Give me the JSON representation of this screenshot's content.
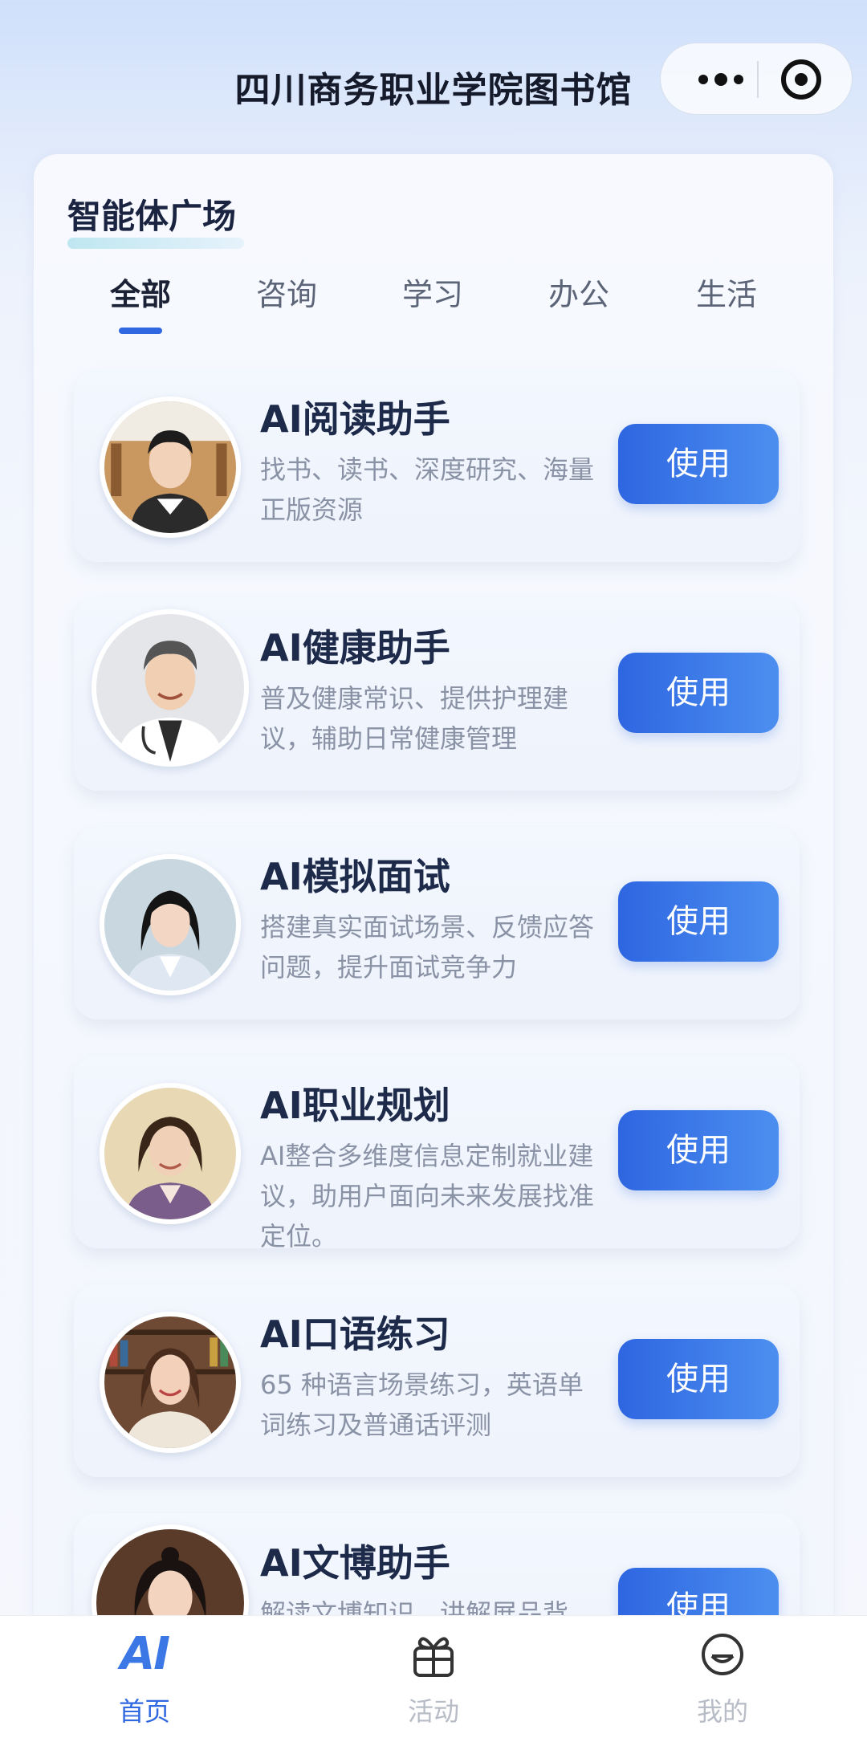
{
  "header": {
    "title": "四川商务职业学院图书馆"
  },
  "section": {
    "title": "智能体广场"
  },
  "tabs": [
    {
      "label": "全部",
      "active": true
    },
    {
      "label": "咨询",
      "active": false
    },
    {
      "label": "学习",
      "active": false
    },
    {
      "label": "办公",
      "active": false
    },
    {
      "label": "生活",
      "active": false
    }
  ],
  "agents": [
    {
      "name": "AI阅读助手",
      "desc": "找书、读书、深度研究、海量正版资源",
      "button": "使用",
      "avatar": "young-man-library-avatar"
    },
    {
      "name": "AI健康助手",
      "desc": "普及健康常识、提供护理建议，辅助日常健康管理",
      "button": "使用",
      "avatar": "doctor-cartoon-avatar"
    },
    {
      "name": "AI模拟面试",
      "desc": "搭建真实面试场景、反馈应答问题，提升面试竞争力",
      "button": "使用",
      "avatar": "young-woman-interview-avatar"
    },
    {
      "name": "AI职业规划",
      "desc": "AI整合多维度信息定制就业建议，助用户面向未来发展找准定位。",
      "button": "使用",
      "avatar": "career-woman-avatar"
    },
    {
      "name": "AI口语练习",
      "desc": "65 种语言场景练习，英语单词练习及普通话评测",
      "button": "使用",
      "avatar": "smiling-woman-bookshelf-avatar"
    },
    {
      "name": "AI文博助手",
      "desc": "解读文博知识，讲解展品背",
      "button": "使用",
      "avatar": "museum-woman-avatar"
    }
  ],
  "bottom_nav": [
    {
      "label": "首页",
      "icon": "ai-logo-icon",
      "active": true
    },
    {
      "label": "活动",
      "icon": "gift-icon",
      "active": false
    },
    {
      "label": "我的",
      "icon": "profile-face-icon",
      "active": false
    }
  ],
  "logo_text": "AI",
  "colors": {
    "accent": "#2f68e0",
    "button_start": "#2e66e1",
    "button_end": "#4c8ff0",
    "muted": "#8a93a6"
  }
}
